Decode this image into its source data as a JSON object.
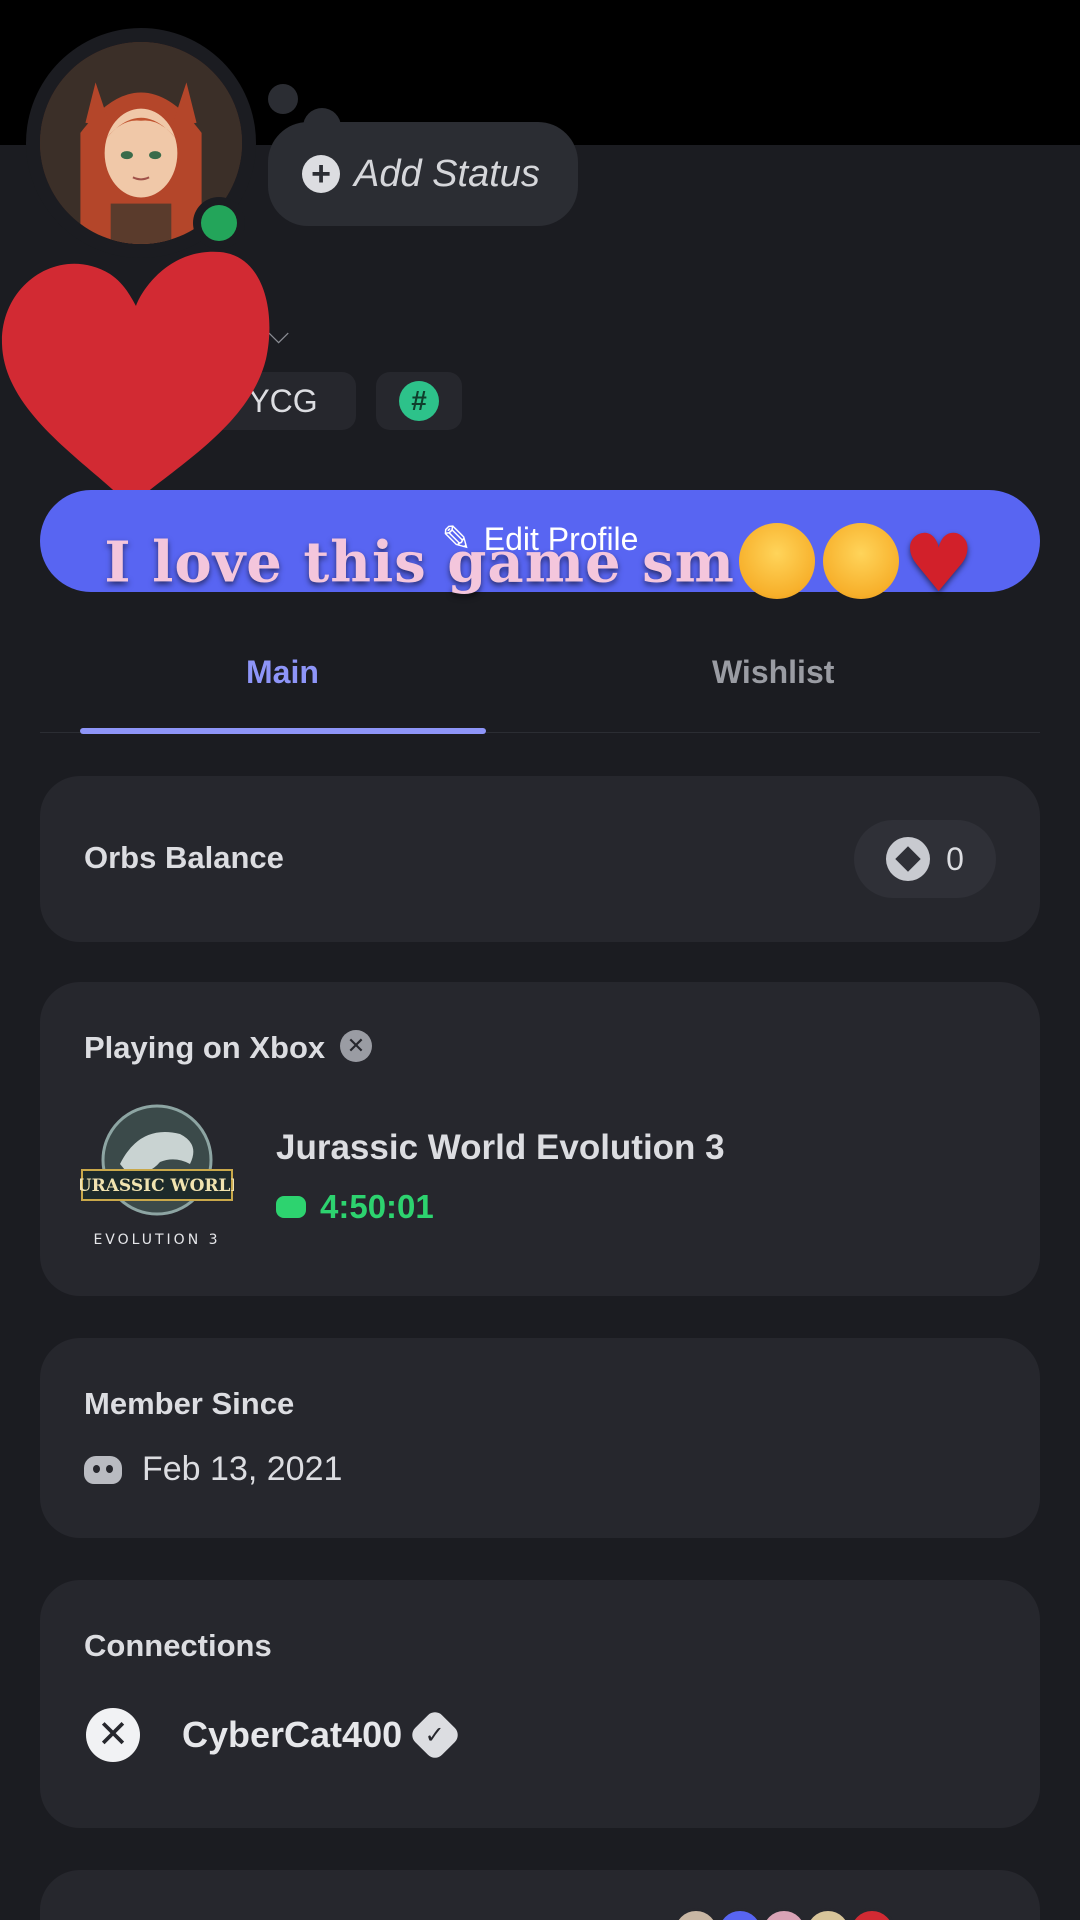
{
  "status": {
    "add_label": "Add Status"
  },
  "badges": {
    "server_tag": "YCG",
    "hash_symbol": "#"
  },
  "profile": {
    "edit_label": "Edit Profile"
  },
  "caption": {
    "text": "I love this game sm"
  },
  "tabs": [
    {
      "label": "Main"
    },
    {
      "label": "Wishlist"
    }
  ],
  "orbs": {
    "title": "Orbs Balance",
    "value": "0"
  },
  "playing": {
    "title": "Playing on Xbox",
    "game": "Jurassic World Evolution 3",
    "elapsed": "4:50:01",
    "art_text_top": "JURASSIC WORLD",
    "art_text_bottom": "EVOLUTION 3"
  },
  "member": {
    "title": "Member Since",
    "date": "Feb 13, 2021"
  },
  "connections": {
    "title": "Connections",
    "account": "CyberCat400"
  },
  "colors": {
    "accent": "#5865f2",
    "online": "#23a55a",
    "playing_green": "#2dd36f",
    "tab_active": "#8e95f8",
    "caption_pink": "#f4c6dc",
    "heart_red": "#d2202a"
  }
}
